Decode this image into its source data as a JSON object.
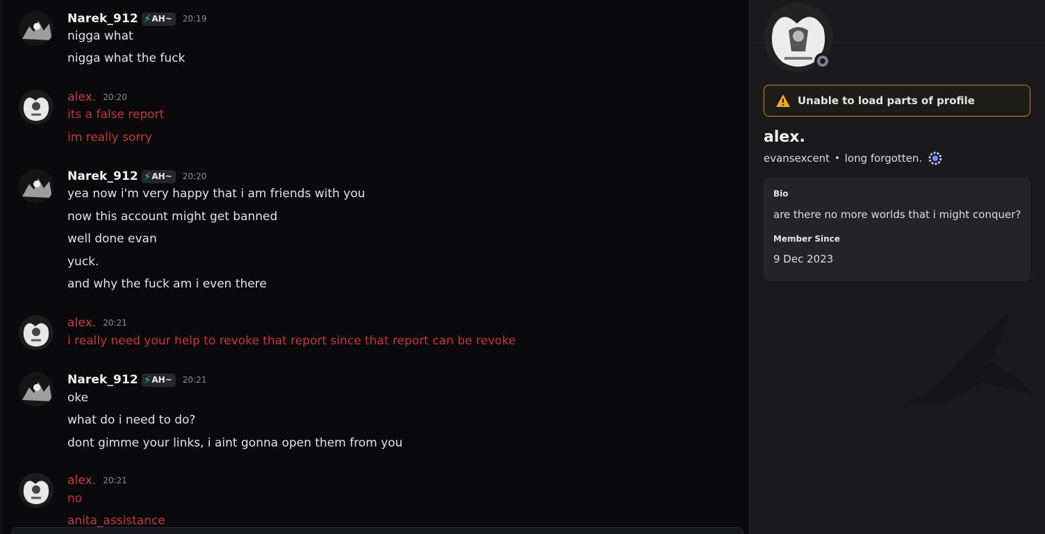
{
  "users": {
    "narek": {
      "name": "Narek_912",
      "tag": "AH~",
      "tag_icon": "lightning-bolt-icon"
    },
    "alex": {
      "name": "alex."
    }
  },
  "messages": [
    {
      "author": "Narek_912",
      "tag": "AH~",
      "time": "20:19",
      "lines": [
        "nigga what",
        "nigga what the fuck"
      ]
    },
    {
      "author": "alex.",
      "time": "20:20",
      "lines": [
        "its a false report",
        "im really sorry"
      ]
    },
    {
      "author": "Narek_912",
      "tag": "AH~",
      "time": "20:20",
      "lines": [
        "yea now i'm very happy that i am friends with you",
        "now this account might get banned",
        "well done evan",
        "yuck.",
        "and why the fuck am i even there"
      ]
    },
    {
      "author": "alex.",
      "time": "20:21",
      "lines": [
        "i really need your help to revoke that report since that report can be revoke"
      ]
    },
    {
      "author": "Narek_912",
      "tag": "AH~",
      "time": "20:21",
      "lines": [
        "oke",
        "what do i need to do?",
        "dont gimme your links, i aint gonna open them from you"
      ]
    },
    {
      "author": "alex.",
      "time": "20:21",
      "lines": [
        "no",
        "anita_assistance"
      ]
    }
  ],
  "profile": {
    "warning": "Unable to load parts of profile",
    "display_name": "alex.",
    "username": "evansexcent",
    "separator": "•",
    "pronouns": "long forgotten.",
    "status": "offline",
    "bio_label": "Bio",
    "bio": "are there no more worlds that i might conquer?",
    "member_since_label": "Member Since",
    "member_since": "9 Dec 2023"
  },
  "colors": {
    "chat_bg": "#0a0a0c",
    "panel_bg": "#1a1a1c",
    "alex_red": "#c7353a",
    "warning_amber": "#c98a17",
    "tag_bolt_green": "#2dd46a"
  }
}
